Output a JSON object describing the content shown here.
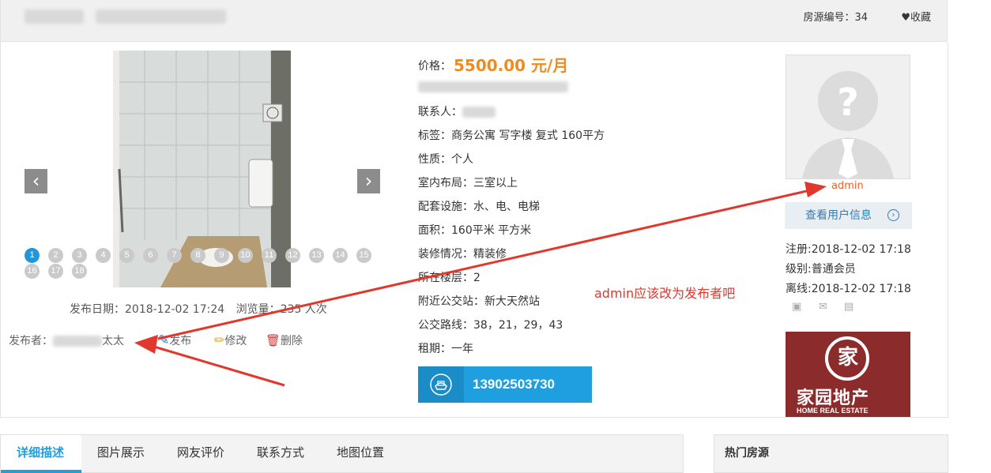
{
  "header": {
    "house_no_label": "房源编号：34",
    "favorite_label": "收藏"
  },
  "gallery": {
    "prev_label": "‹",
    "next_label": "›",
    "pages": [
      "1",
      "2",
      "3",
      "4",
      "5",
      "6",
      "7",
      "8",
      "9",
      "10",
      "11",
      "12",
      "13",
      "14",
      "15",
      "16",
      "17",
      "18"
    ],
    "active_page": "1"
  },
  "listing_meta": {
    "publish_date": "发布日期：2018-12-02 17:24",
    "views": "浏览量：235 人次",
    "publisher_label": "发布者：",
    "publisher_suffix": "太太",
    "actions": {
      "publish": "发布",
      "edit": "修改",
      "delete": "删除"
    }
  },
  "info": {
    "price_label": "价格：",
    "price_value": "5500.00 元/月",
    "contact_label": "联系人：",
    "rows": [
      "标签：商务公寓 写字楼 复式 160平方",
      "性质：个人",
      "室内布局：三室以上",
      "配套设施：水、电、电梯",
      "面积：160平米 平方米",
      "装修情况：精装修",
      "所在楼层：2",
      "附近公交站：新大天然站",
      "公交路线：38，21，29，43",
      "租期：一年"
    ],
    "phone": "13902503730"
  },
  "user": {
    "name": "admin",
    "view_button": "查看用户信息",
    "register": "注册:2018-12-02 17:18",
    "level": "级别:普通会员",
    "offline": "离线:2018-12-02 17:18"
  },
  "ad": {
    "text_cn": "家园地产",
    "text_en": "HOME REAL ESTATE"
  },
  "annotation": "admin应该改为发布者吧",
  "tabs": [
    "详细描述",
    "图片展示",
    "网友评价",
    "联系方式",
    "地图位置"
  ],
  "active_tab": "详细描述",
  "hot": {
    "title": "热门房源"
  },
  "colors": {
    "accent": "#1f9fe0",
    "price": "#f08c1c",
    "annotation": "#e2372d",
    "user": "#e8632e"
  }
}
